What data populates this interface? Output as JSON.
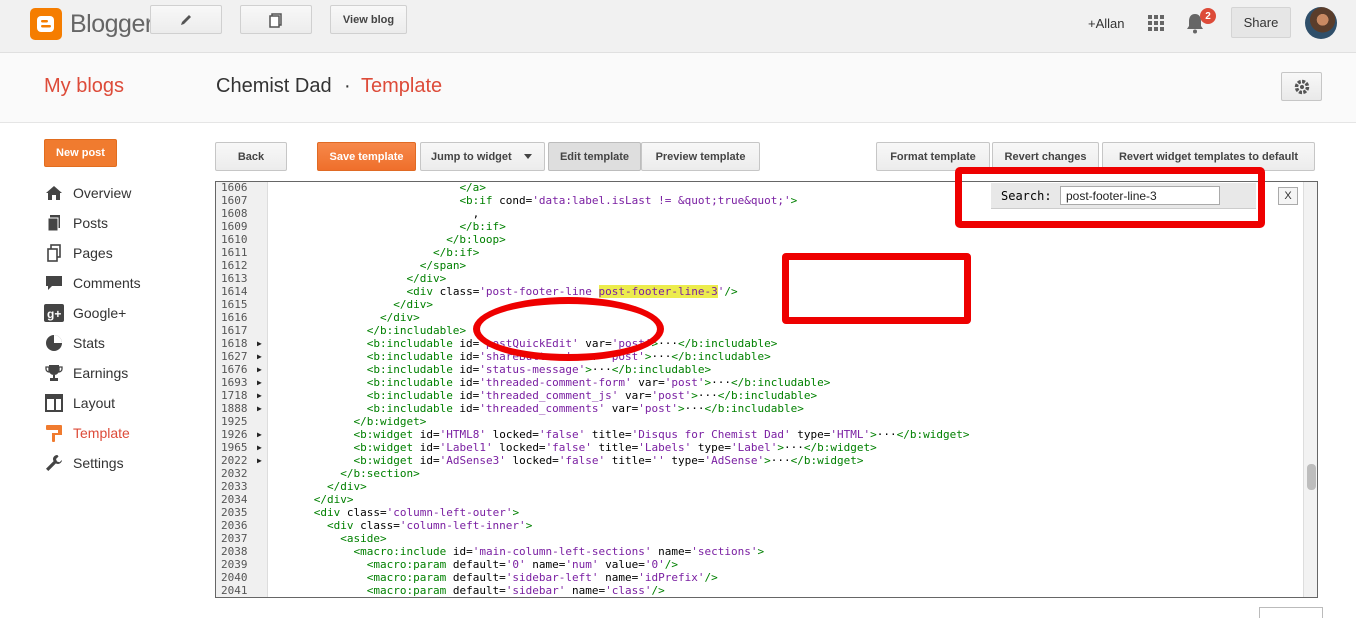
{
  "topbar": {
    "brand": "Blogger",
    "view_blog": "View blog",
    "plus_user": "+Allan",
    "notification_count": "2",
    "share": "Share",
    "icons": [
      "pencil-icon",
      "pages-icon",
      "apps-grid-icon",
      "bell-icon"
    ]
  },
  "header": {
    "my_blogs": "My blogs",
    "blog_title": "Chemist Dad",
    "separator": "·",
    "page_title": "Template"
  },
  "sidebar": {
    "new_post": "New post",
    "items": [
      {
        "label": "Overview",
        "icon": "home-icon"
      },
      {
        "label": "Posts",
        "icon": "posts-icon"
      },
      {
        "label": "Pages",
        "icon": "pages-icon"
      },
      {
        "label": "Comments",
        "icon": "comments-icon"
      },
      {
        "label": "Google+",
        "icon": "google-plus-icon"
      },
      {
        "label": "Stats",
        "icon": "stats-icon"
      },
      {
        "label": "Earnings",
        "icon": "trophy-icon"
      },
      {
        "label": "Layout",
        "icon": "layout-icon"
      },
      {
        "label": "Template",
        "icon": "template-icon",
        "active": true
      },
      {
        "label": "Settings",
        "icon": "wrench-icon"
      }
    ]
  },
  "toolbar": {
    "back": "Back",
    "save_template": "Save template",
    "jump_to_widget": "Jump to widget",
    "edit_template": "Edit template",
    "preview_template": "Preview template",
    "format_template": "Format template",
    "revert_changes": "Revert changes",
    "revert_widgets": "Revert widget templates to default"
  },
  "search": {
    "label": "Search:",
    "value": "post-footer-line-3",
    "close": "X"
  },
  "colors": {
    "accent": "#dd4b39",
    "annotation": "#ee0000",
    "highlight": "#ecec4c"
  },
  "editor": {
    "lines": [
      {
        "n": "1606",
        "fold": false,
        "code": "                            </a>"
      },
      {
        "n": "1607",
        "fold": false,
        "code": "                            <b:if cond='data:label.isLast != &quot;true&quot;'>"
      },
      {
        "n": "1608",
        "fold": false,
        "code": "                              ,"
      },
      {
        "n": "1609",
        "fold": false,
        "code": "                            </b:if>"
      },
      {
        "n": "1610",
        "fold": false,
        "code": "                          </b:loop>"
      },
      {
        "n": "1611",
        "fold": false,
        "code": "                        </b:if>"
      },
      {
        "n": "1612",
        "fold": false,
        "code": "                      </span>"
      },
      {
        "n": "1613",
        "fold": false,
        "code": "                    </div>"
      },
      {
        "n": "1614",
        "fold": false,
        "code": "                    <div class='post-footer-line post-footer-line-3'/>"
      },
      {
        "n": "1615",
        "fold": false,
        "code": "                  </div>"
      },
      {
        "n": "1616",
        "fold": false,
        "code": "                </div>"
      },
      {
        "n": "1617",
        "fold": false,
        "code": "              </b:includable>"
      },
      {
        "n": "1618",
        "fold": true,
        "code": "              <b:includable id='postQuickEdit' var='post'>···</b:includable>"
      },
      {
        "n": "1627",
        "fold": true,
        "code": "              <b:includable id='shareButtons' var='post'>···</b:includable>"
      },
      {
        "n": "1676",
        "fold": true,
        "code": "              <b:includable id='status-message'>···</b:includable>"
      },
      {
        "n": "1693",
        "fold": true,
        "code": "              <b:includable id='threaded-comment-form' var='post'>···</b:includable>"
      },
      {
        "n": "1718",
        "fold": true,
        "code": "              <b:includable id='threaded_comment_js' var='post'>···</b:includable>"
      },
      {
        "n": "1888",
        "fold": true,
        "code": "              <b:includable id='threaded_comments' var='post'>···</b:includable>"
      },
      {
        "n": "1925",
        "fold": false,
        "code": "            </b:widget>"
      },
      {
        "n": "1926",
        "fold": true,
        "code": "            <b:widget id='HTML8' locked='false' title='Disqus for Chemist Dad' type='HTML'>···</b:widget>"
      },
      {
        "n": "1965",
        "fold": true,
        "code": "            <b:widget id='Label1' locked='false' title='Labels' type='Label'>···</b:widget>"
      },
      {
        "n": "2022",
        "fold": true,
        "code": "            <b:widget id='AdSense3' locked='false' title='' type='AdSense'>···</b:widget>"
      },
      {
        "n": "2032",
        "fold": false,
        "code": "          </b:section>"
      },
      {
        "n": "2033",
        "fold": false,
        "code": "        </div>"
      },
      {
        "n": "2034",
        "fold": false,
        "code": "      </div>"
      },
      {
        "n": "2035",
        "fold": false,
        "code": "      <div class='column-left-outer'>"
      },
      {
        "n": "2036",
        "fold": false,
        "code": "        <div class='column-left-inner'>"
      },
      {
        "n": "2037",
        "fold": false,
        "code": "          <aside>"
      },
      {
        "n": "2038",
        "fold": false,
        "code": "            <macro:include id='main-column-left-sections' name='sections'>"
      },
      {
        "n": "2039",
        "fold": false,
        "code": "              <macro:param default='0' name='num' value='0'/>"
      },
      {
        "n": "2040",
        "fold": false,
        "code": "              <macro:param default='sidebar-left' name='idPrefix'/>"
      },
      {
        "n": "2041",
        "fold": false,
        "code": "              <macro:param default='sidebar' name='class'/>"
      }
    ]
  }
}
